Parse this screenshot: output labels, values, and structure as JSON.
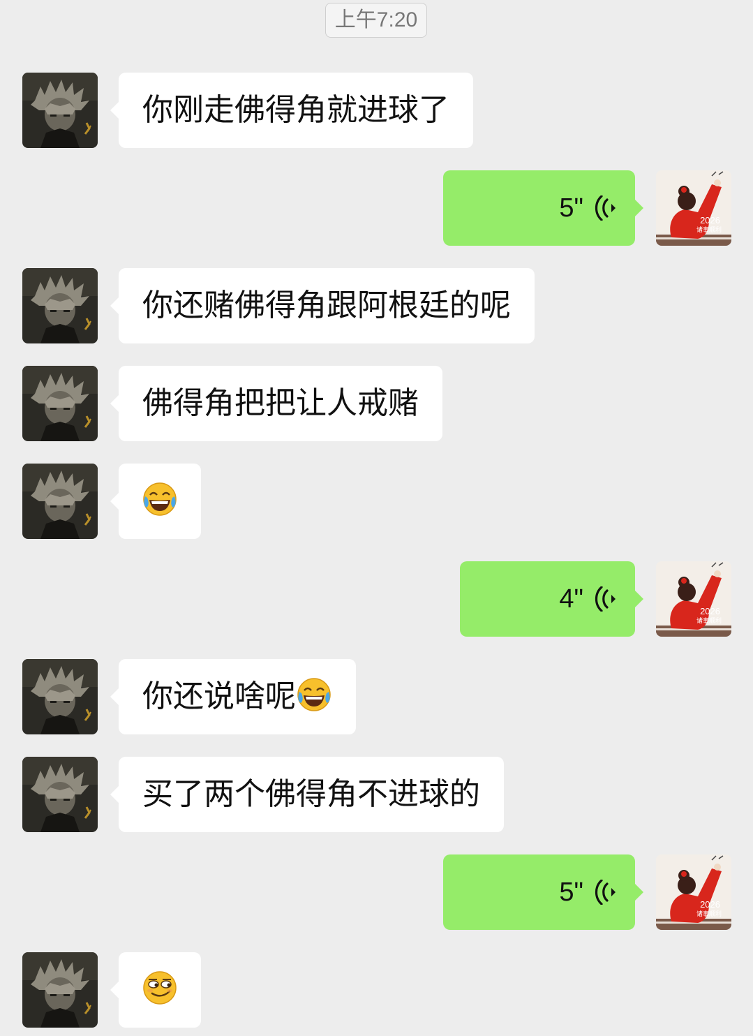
{
  "timestamp": "上午7:20",
  "messages": [
    {
      "text": "你刚走佛得角就进球了"
    },
    {
      "duration": "5\""
    },
    {
      "text": "你还赌佛得角跟阿根廷的呢"
    },
    {
      "text": "佛得角把把让人戒赌"
    },
    {
      "emoji": "tears-of-joy-emoji"
    },
    {
      "duration": "4\""
    },
    {
      "text": "你还说啥呢"
    },
    {
      "text": "买了两个佛得角不进球的"
    },
    {
      "duration": "5\""
    },
    {
      "emoji": "smirking-face-emoji"
    }
  ],
  "self_avatar_text": "2026",
  "self_avatar_caption": "诸事顺利",
  "colors": {
    "background": "#ededed",
    "incoming_bubble": "#ffffff",
    "outgoing_bubble": "#95ec69",
    "avatar_red": "#d8261c"
  }
}
